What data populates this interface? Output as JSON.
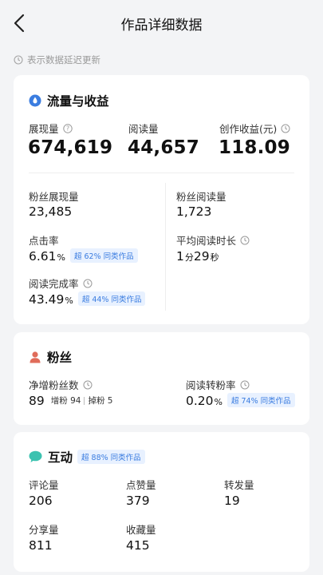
{
  "header": {
    "title": "作品详细数据"
  },
  "notice": {
    "text": "表示数据延迟更新"
  },
  "traffic": {
    "title": "流量与收益",
    "impressions": {
      "label": "展现量",
      "value": "674,619"
    },
    "reads": {
      "label": "阅读量",
      "value": "44,657"
    },
    "earnings": {
      "label": "创作收益(元)",
      "value": "118.09"
    },
    "fan_impressions": {
      "label": "粉丝展现量",
      "value": "23,485"
    },
    "fan_reads": {
      "label": "粉丝阅读量",
      "value": "1,723"
    },
    "ctr": {
      "label": "点击率",
      "value": "6.61",
      "unit": "%",
      "badge": "超 62% 同类作品"
    },
    "avg_read_time": {
      "label": "平均阅读时长",
      "min": "1",
      "min_unit": "分",
      "sec": "29",
      "sec_unit": "秒"
    },
    "completion": {
      "label": "阅读完成率",
      "value": "43.49",
      "unit": "%",
      "badge": "超 44% 同类作品"
    }
  },
  "fans": {
    "title": "粉丝",
    "net_gain": {
      "label": "净增粉丝数",
      "value": "89",
      "gain_label": "增粉",
      "gain": "94",
      "loss_label": "掉粉",
      "loss": "5"
    },
    "conversion": {
      "label": "阅读转粉率",
      "value": "0.20",
      "unit": "%",
      "badge": "超 74% 同类作品"
    }
  },
  "interaction": {
    "title": "互动",
    "badge": "超 88% 同类作品",
    "comments": {
      "label": "评论量",
      "value": "206"
    },
    "likes": {
      "label": "点赞量",
      "value": "379"
    },
    "reposts": {
      "label": "转发量",
      "value": "19"
    },
    "shares": {
      "label": "分享量",
      "value": "811"
    },
    "favorites": {
      "label": "收藏量",
      "value": "415"
    }
  },
  "colors": {
    "accent": "#3b7de0",
    "fans_icon": "#e06c5a",
    "interaction_icon": "#3cc2b0",
    "badge_bg": "#e8f1ff"
  },
  "icons": [
    "back-arrow-icon",
    "clock-icon",
    "shield-drop-icon",
    "help-icon",
    "person-icon",
    "chat-bubble-icon"
  ]
}
